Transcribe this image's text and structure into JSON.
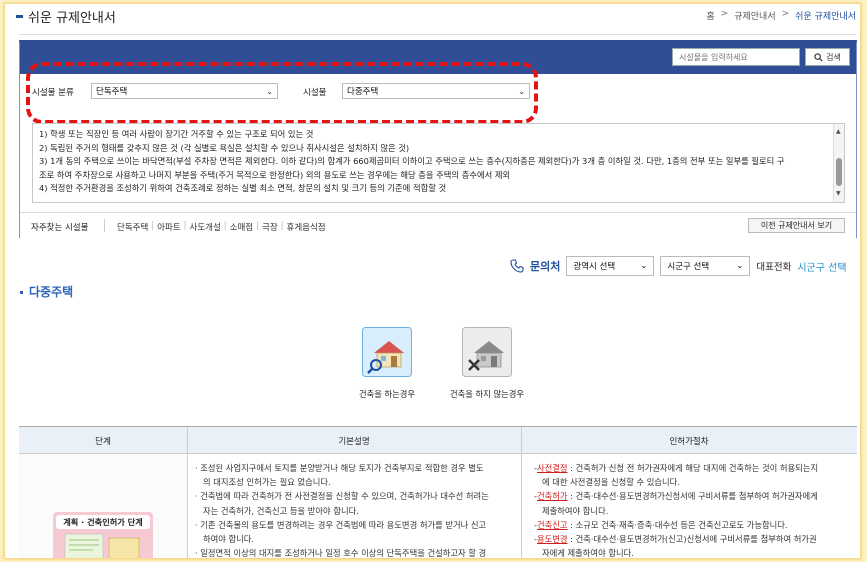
{
  "header": {
    "title": "쉬운 규제안내서",
    "breadcrumb": [
      "홈",
      "규제안내서",
      "쉬운 규제안내서"
    ]
  },
  "search": {
    "placeholder": "시설물을 입력하세요",
    "button_label": "검색"
  },
  "filters": {
    "category_label": "시설물 분류",
    "category_value": "단독주택",
    "facility_label": "시설물",
    "facility_value": "다중주택"
  },
  "description": {
    "lines": [
      "1) 학생 또는 직장인 등 여러 사람이 장기간 거주할 수 있는 구조로 되어 있는 것",
      "2) 독립된 주거의 형태를 갖추지 않은 것 (각 실별로 욕실은 설치할 수 있으나 취사시설은 설치하지 않은 것)",
      "3) 1개 동의 주택으로 쓰이는 바닥면적(부설 주차장 면적은 제외한다. 이하 같다)의 합계가 660제곱미터 이하이고 주택으로 쓰는 층수(지하층은 제외한다)가 3개 층 이하일 것. 다만, 1층의 전부 또는 일부를 필로티 구",
      "조로 하여 주차장으로 사용하고 나머지 부분을 주택(주거 목적으로 한정한다) 외의 용도로 쓰는 경우에는 해당 층을 주택의 층수에서 제외",
      "4) 적정한 주거환경을 조성하기 위하여 건축조례로 정하는 실별 최소 면적, 창문의 설치 및 크기 등의 기준에 적합할 것"
    ]
  },
  "frequent": {
    "label": "자주찾는 시설물",
    "items": [
      "단독주택",
      "아파트",
      "사도개설",
      "소매점",
      "극장",
      "휴게음식점"
    ],
    "prev_button": "이전 규제안내서 보기"
  },
  "contact": {
    "title": "문의처",
    "province_select": "광역시 선택",
    "district_select": "시군구 선택",
    "rep_label": "대표전화",
    "rep_value": "시군구 선택"
  },
  "section": {
    "title": "다중주택",
    "choices": [
      "건축을 하는경우",
      "건축을 하지 않는경우"
    ]
  },
  "table": {
    "headers": [
      "단계",
      "기본설명",
      "인허가절차"
    ],
    "stage_image_text": "계획 · 건축인허가 단계",
    "basic": [
      "· 조성된 사업지구에서 토지를 분양받거나 해당 토지가 건축부지로 적합한 경우 별도",
      "의 대지조성 인허가는 필요 없습니다.",
      "· 건축법에 따라 건축허가 전 사전결정을 신청할 수 있으며, 건축허가나 대수선 허려는",
      "자는 건축허가, 건축신고 등을 받아야 합니다.",
      "· 기존 건축물의 용도를 변경하려는 경우 건축법에 따라 용도변경 허가를 받거나 신고",
      "하여야 합니다.",
      "· 일정면적 이상의 대지를 조성하거나 일정 호수 이상의 단독주택을 건설하고자 할 경"
    ],
    "procedures": [
      {
        "term": "사전결정",
        "text": " : 건축허가 신청 전 허가권자에게 해당 대지에 건축하는 것이 허용되는지",
        "cont": "에 대한 사전결정을 신청할 수 있습니다."
      },
      {
        "term": "건축허가",
        "text": " : 건축·대수선·용도변경허가신청서에 구비서류를 첨부하여 허가권자에게",
        "cont": "제출하여야 합니다."
      },
      {
        "term": "건축신고",
        "text": " : 소규모 건축·재축·증축·대수선 등은 건축신고로도 가능합니다.",
        "cont": ""
      },
      {
        "term": "용도변경",
        "text": " : 건축·대수선·용도변경허가(신고)신청서에 구비서류를 첨부하여 허가권",
        "cont": "자에게 제출하여야 합니다."
      }
    ]
  },
  "colors": {
    "primary": "#2f4e96",
    "highlight": "#e61313",
    "link": "#1f8fce"
  }
}
